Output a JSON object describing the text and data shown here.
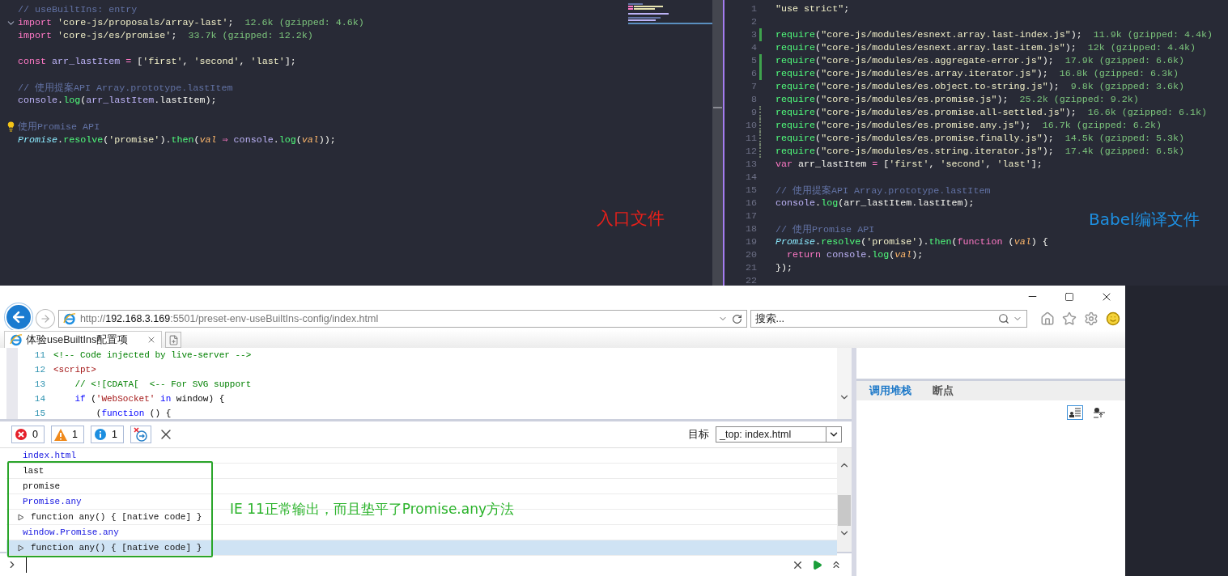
{
  "entry_editor": {
    "lines": [
      {
        "kind": "code",
        "tokens": [
          {
            "t": "// useBuiltIns: entry",
            "kind": "cmt"
          }
        ]
      },
      {
        "kind": "fold",
        "tokens": [
          {
            "t": "import",
            "kind": "kw"
          },
          {
            "t": " 'core-js/proposals/array-last'",
            "kind": "str"
          },
          {
            "t": ";",
            "kind": "plain"
          }
        ],
        "size": "12.6k (gzipped: 4.6k)"
      },
      {
        "kind": "code",
        "tokens": [
          {
            "t": "import",
            "kind": "kw"
          },
          {
            "t": " 'core-js/es/promise'",
            "kind": "str"
          },
          {
            "t": ";",
            "kind": "plain"
          }
        ],
        "size": "33.7k (gzipped: 12.2k)"
      },
      {
        "kind": "blank"
      },
      {
        "kind": "code",
        "tokens": [
          {
            "t": "const",
            "kind": "kw"
          },
          {
            "t": " arr_lastItem",
            "kind": "var"
          },
          {
            "t": " = ",
            "kind": "kw"
          },
          {
            "t": "[",
            "kind": "plain"
          },
          {
            "t": "'first'",
            "kind": "str"
          },
          {
            "t": ", ",
            "kind": "plain"
          },
          {
            "t": "'second'",
            "kind": "str"
          },
          {
            "t": ", ",
            "kind": "plain"
          },
          {
            "t": "'last'",
            "kind": "str"
          },
          {
            "t": "];",
            "kind": "plain"
          }
        ]
      },
      {
        "kind": "blank"
      },
      {
        "kind": "code",
        "tokens": [
          {
            "t": "// 使用提案API Array.prototype.lastItem",
            "kind": "cmt"
          }
        ]
      },
      {
        "kind": "code",
        "tokens": [
          {
            "t": "console",
            "kind": "var"
          },
          {
            "t": ".",
            "kind": "plain"
          },
          {
            "t": "log",
            "kind": "fn"
          },
          {
            "t": "(",
            "kind": "plain"
          },
          {
            "t": "arr_lastItem",
            "kind": "var"
          },
          {
            "t": ".lastItem);",
            "kind": "plain"
          }
        ]
      },
      {
        "kind": "blank"
      },
      {
        "kind": "bulb",
        "tokens": [
          {
            "t": "使用Promise API",
            "kind": "cmt"
          }
        ]
      },
      {
        "kind": "code",
        "tokens": [
          {
            "t": "Promise",
            "kind": "cls"
          },
          {
            "t": ".",
            "kind": "plain"
          },
          {
            "t": "resolve",
            "kind": "fn"
          },
          {
            "t": "(",
            "kind": "plain"
          },
          {
            "t": "'promise'",
            "kind": "str"
          },
          {
            "t": ").",
            "kind": "plain"
          },
          {
            "t": "then",
            "kind": "fn"
          },
          {
            "t": "(",
            "kind": "plain"
          },
          {
            "t": "val",
            "kind": "param"
          },
          {
            "t": " ⇒ ",
            "kind": "kw"
          },
          {
            "t": "console",
            "kind": "var"
          },
          {
            "t": ".",
            "kind": "plain"
          },
          {
            "t": "log",
            "kind": "fn"
          },
          {
            "t": "(",
            "kind": "plain"
          },
          {
            "t": "val",
            "kind": "param"
          },
          {
            "t": "));",
            "kind": "plain"
          }
        ]
      }
    ]
  },
  "compiled_editor": {
    "lines": [
      {
        "n": "1",
        "kind": "code",
        "tokens": [
          {
            "t": "\"use strict\"",
            "kind": "str"
          },
          {
            "t": ";",
            "kind": "plain"
          }
        ]
      },
      {
        "n": "2",
        "kind": "code"
      },
      {
        "n": "3",
        "kind": "added",
        "tokens": [
          {
            "t": "require",
            "kind": "fn"
          },
          {
            "t": "(",
            "kind": "plain"
          },
          {
            "t": "\"core-js/modules/esnext.array.last-index.js\"",
            "kind": "str"
          },
          {
            "t": ");",
            "kind": "plain"
          }
        ],
        "size": "11.9k (gzipped: 4.4k)"
      },
      {
        "n": "4",
        "kind": "code",
        "tokens": [
          {
            "t": "require",
            "kind": "fn"
          },
          {
            "t": "(",
            "kind": "plain"
          },
          {
            "t": "\"core-js/modules/esnext.array.last-item.js\"",
            "kind": "str"
          },
          {
            "t": ");",
            "kind": "plain"
          }
        ],
        "size": "12k (gzipped: 4.4k)"
      },
      {
        "n": "5",
        "kind": "added",
        "tokens": [
          {
            "t": "require",
            "kind": "fn"
          },
          {
            "t": "(",
            "kind": "plain"
          },
          {
            "t": "\"core-js/modules/es.aggregate-error.js\"",
            "kind": "str"
          },
          {
            "t": ");",
            "kind": "plain"
          }
        ],
        "size": "17.9k (gzipped: 6.6k)"
      },
      {
        "n": "6",
        "kind": "added",
        "tokens": [
          {
            "t": "require",
            "kind": "fn"
          },
          {
            "t": "(",
            "kind": "plain"
          },
          {
            "t": "\"core-js/modules/es.array.iterator.js\"",
            "kind": "str"
          },
          {
            "t": ");",
            "kind": "plain"
          }
        ],
        "size": "16.8k (gzipped: 6.3k)"
      },
      {
        "n": "7",
        "kind": "code",
        "tokens": [
          {
            "t": "require",
            "kind": "fn"
          },
          {
            "t": "(",
            "kind": "plain"
          },
          {
            "t": "\"core-js/modules/es.object.to-string.js\"",
            "kind": "str"
          },
          {
            "t": ");",
            "kind": "plain"
          }
        ],
        "size": "9.8k (gzipped: 3.6k)"
      },
      {
        "n": "8",
        "kind": "code",
        "tokens": [
          {
            "t": "require",
            "kind": "fn"
          },
          {
            "t": "(",
            "kind": "plain"
          },
          {
            "t": "\"core-js/modules/es.promise.js\"",
            "kind": "str"
          },
          {
            "t": ");",
            "kind": "plain"
          }
        ],
        "size": "25.2k (gzipped: 9.2k)"
      },
      {
        "n": "9",
        "kind": "changed",
        "tokens": [
          {
            "t": "require",
            "kind": "fn"
          },
          {
            "t": "(",
            "kind": "plain"
          },
          {
            "t": "\"core-js/modules/es.promise.all-settled.js\"",
            "kind": "str"
          },
          {
            "t": ");",
            "kind": "plain"
          }
        ],
        "size": "16.6k (gzipped: 6.1k)"
      },
      {
        "n": "10",
        "kind": "changed",
        "tokens": [
          {
            "t": "require",
            "kind": "fn"
          },
          {
            "t": "(",
            "kind": "plain"
          },
          {
            "t": "\"core-js/modules/es.promise.any.js\"",
            "kind": "str"
          },
          {
            "t": ");",
            "kind": "plain"
          }
        ],
        "size": "16.7k (gzipped: 6.2k)"
      },
      {
        "n": "11",
        "kind": "changed",
        "tokens": [
          {
            "t": "require",
            "kind": "fn"
          },
          {
            "t": "(",
            "kind": "plain"
          },
          {
            "t": "\"core-js/modules/es.promise.finally.js\"",
            "kind": "str"
          },
          {
            "t": ");",
            "kind": "plain"
          }
        ],
        "size": "14.5k (gzipped: 5.3k)"
      },
      {
        "n": "12",
        "kind": "changed",
        "tokens": [
          {
            "t": "require",
            "kind": "fn"
          },
          {
            "t": "(",
            "kind": "plain"
          },
          {
            "t": "\"core-js/modules/es.string.iterator.js\"",
            "kind": "str"
          },
          {
            "t": ");",
            "kind": "plain"
          }
        ],
        "size": "17.4k (gzipped: 6.5k)"
      },
      {
        "n": "13",
        "kind": "code",
        "tokens": [
          {
            "t": "var",
            "kind": "kw"
          },
          {
            "t": " arr_lastItem ",
            "kind": "plain"
          },
          {
            "t": "=",
            "kind": "kw"
          },
          {
            "t": " [",
            "kind": "plain"
          },
          {
            "t": "'first'",
            "kind": "str"
          },
          {
            "t": ", ",
            "kind": "plain"
          },
          {
            "t": "'second'",
            "kind": "str"
          },
          {
            "t": ", ",
            "kind": "plain"
          },
          {
            "t": "'last'",
            "kind": "str"
          },
          {
            "t": "];",
            "kind": "plain"
          }
        ]
      },
      {
        "n": "14",
        "kind": "code"
      },
      {
        "n": "15",
        "kind": "code",
        "tokens": [
          {
            "t": "// 使用提案API Array.prototype.lastItem",
            "kind": "cmt"
          }
        ]
      },
      {
        "n": "16",
        "kind": "code",
        "tokens": [
          {
            "t": "console",
            "kind": "var"
          },
          {
            "t": ".",
            "kind": "plain"
          },
          {
            "t": "log",
            "kind": "fn"
          },
          {
            "t": "(arr_lastItem.lastItem);",
            "kind": "plain"
          }
        ]
      },
      {
        "n": "17",
        "kind": "code"
      },
      {
        "n": "18",
        "kind": "code",
        "tokens": [
          {
            "t": "// 使用Promise API",
            "kind": "cmt"
          }
        ]
      },
      {
        "n": "19",
        "kind": "code",
        "tokens": [
          {
            "t": "Promise",
            "kind": "cls"
          },
          {
            "t": ".",
            "kind": "plain"
          },
          {
            "t": "resolve",
            "kind": "fn"
          },
          {
            "t": "(",
            "kind": "plain"
          },
          {
            "t": "'promise'",
            "kind": "str"
          },
          {
            "t": ").",
            "kind": "plain"
          },
          {
            "t": "then",
            "kind": "fn"
          },
          {
            "t": "(",
            "kind": "plain"
          },
          {
            "t": "function",
            "kind": "kw"
          },
          {
            "t": " (",
            "kind": "plain"
          },
          {
            "t": "val",
            "kind": "param"
          },
          {
            "t": ") {",
            "kind": "plain"
          }
        ]
      },
      {
        "n": "20",
        "kind": "code",
        "tokens": [
          {
            "t": "  return",
            "kind": "kw"
          },
          {
            "t": " console",
            "kind": "var"
          },
          {
            "t": ".",
            "kind": "plain"
          },
          {
            "t": "log",
            "kind": "fn"
          },
          {
            "t": "(",
            "kind": "plain"
          },
          {
            "t": "val",
            "kind": "param"
          },
          {
            "t": ");",
            "kind": "plain"
          }
        ]
      },
      {
        "n": "21",
        "kind": "code",
        "tokens": [
          {
            "t": "});",
            "kind": "plain"
          }
        ]
      },
      {
        "n": "22",
        "kind": "code"
      }
    ]
  },
  "annotations": {
    "entry_label": "入口文件",
    "compiled_label": "Babel编译文件",
    "console_note": "IE 11正常输出，而且垫平了Promise.any方法"
  },
  "browser": {
    "url": {
      "scheme": "http://",
      "host": "192.168.3.169",
      "path": ":5501/preset-env-useBuiltIns-config/index.html"
    },
    "search_placeholder": "搜索...",
    "tab_title": "体验useBuiltIns配置项",
    "source_lines": [
      {
        "n": "11",
        "tokens": [
          {
            "t": "<!-- Code injected by live-server -->",
            "kind": "cmt"
          }
        ]
      },
      {
        "n": "12",
        "tokens": [
          {
            "t": "<script>",
            "kind": "tag"
          }
        ]
      },
      {
        "n": "13",
        "tokens": [
          {
            "t": "    // <![CDATA[  <-- For SVG support",
            "kind": "cmt"
          }
        ]
      },
      {
        "n": "14",
        "tokens": [
          {
            "t": "    if",
            "kind": "kw"
          },
          {
            "t": " (",
            "kind": "plain"
          },
          {
            "t": "'WebSocket'",
            "kind": "str"
          },
          {
            "t": " in",
            "kind": "kw"
          },
          {
            "t": " window) {",
            "kind": "plain"
          }
        ]
      },
      {
        "n": "15",
        "tokens": [
          {
            "t": "        (",
            "kind": "plain"
          },
          {
            "t": "function",
            "kind": "kw"
          },
          {
            "t": " () {",
            "kind": "plain"
          }
        ]
      }
    ],
    "console_counters": [
      {
        "kind": "error",
        "count": "0"
      },
      {
        "kind": "warning",
        "count": "1"
      },
      {
        "kind": "info",
        "count": "1"
      }
    ],
    "target_label": "目标",
    "target_value": "_top: index.html",
    "console_rows": [
      {
        "kind": "input",
        "text": "index.html",
        "selected": false
      }
    ],
    "framed_rows": [
      {
        "kind": "output",
        "text": "last",
        "selected": false
      },
      {
        "kind": "output",
        "text": "promise",
        "selected": false
      },
      {
        "kind": "input",
        "text": "Promise.any",
        "selected": false
      },
      {
        "kind": "object",
        "text": "function any() { [native code] }",
        "selected": false
      },
      {
        "kind": "input",
        "text": "window.Promise.any",
        "selected": false
      },
      {
        "kind": "object",
        "text": "function any() { [native code] }",
        "selected": true
      }
    ],
    "devtools_tabs": [
      {
        "label": "调用堆栈",
        "selected": true
      },
      {
        "label": "断点",
        "selected": false
      }
    ]
  }
}
